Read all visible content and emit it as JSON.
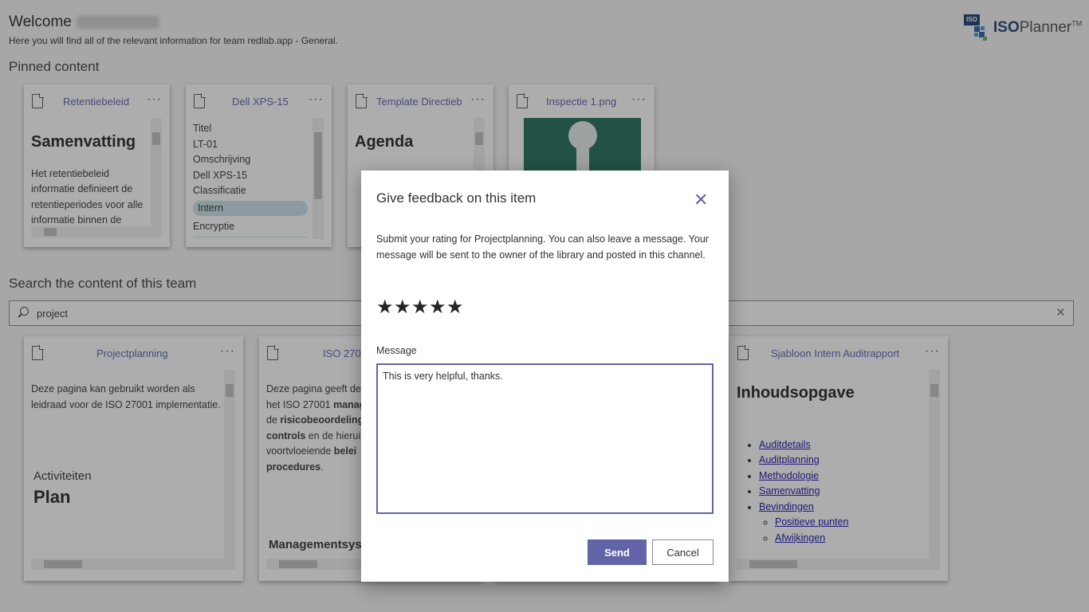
{
  "header": {
    "welcome": "Welcome",
    "subtitle": "Here you will find all of the relevant information for team redlab.app - General."
  },
  "logo": {
    "iso": "ISO",
    "text_bold": "ISO",
    "text_rest": "Planner",
    "tm": "TM"
  },
  "pinned": {
    "title": "Pinned content",
    "cards": [
      {
        "title": "Retentiebeleid",
        "heading": "Samenvatting",
        "body": "Het retentiebeleid informatie definieert de retentieperiodes voor alle informatie binnen de"
      },
      {
        "title": "Dell XPS-15",
        "fields": [
          {
            "label": "Titel",
            "value": "LT-01"
          },
          {
            "label": "Omschrijving",
            "value": "Dell XPS-15"
          },
          {
            "label": "Classificatie",
            "value": "Intern"
          },
          {
            "label": "Encryptie",
            "value": ""
          }
        ]
      },
      {
        "title": "Template Directieb",
        "heading": "Agenda"
      },
      {
        "title": "Inspectie 1.png"
      }
    ]
  },
  "search": {
    "title": "Search the content of this team",
    "value": "project",
    "results": [
      {
        "title": "Projectplanning",
        "body": "Deze pagina kan gebruikt worden als leidraad voor de ISO 27001 implementatie.",
        "label": "Activiteiten",
        "heading": "Plan"
      },
      {
        "title": "ISO 2700",
        "body_parts": [
          "Deze pagina geeft de",
          "het ISO 27001 ",
          "manag",
          "de ",
          "risicobeoordeling",
          "controls",
          " en de hierui",
          "voortvloeiende ",
          "belei",
          "procedures",
          "."
        ],
        "footer": "Managementsyst"
      },
      {
        "title": "Sjabloon Intern Auditrapport",
        "heading": "Inhoudsopgave",
        "toc": [
          "Auditdetails",
          "Auditplanning",
          "Methodologie",
          "Samenvatting",
          "Bevindingen"
        ],
        "subtoc": [
          "Positieve punten",
          "Afwijkingen"
        ]
      }
    ]
  },
  "dialog": {
    "title": "Give feedback on this item",
    "close": "✕",
    "description": "Submit your rating for Projectplanning. You can also leave a message. Your message will be sent to the owner of the library and posted in this channel.",
    "rating": 5,
    "stars": [
      "★",
      "★",
      "★",
      "★",
      "★"
    ],
    "message_label": "Message",
    "message_value": "This is very helpful, thanks.",
    "send_label": "Send",
    "cancel_label": "Cancel",
    "accent_color": "#6264a7"
  }
}
